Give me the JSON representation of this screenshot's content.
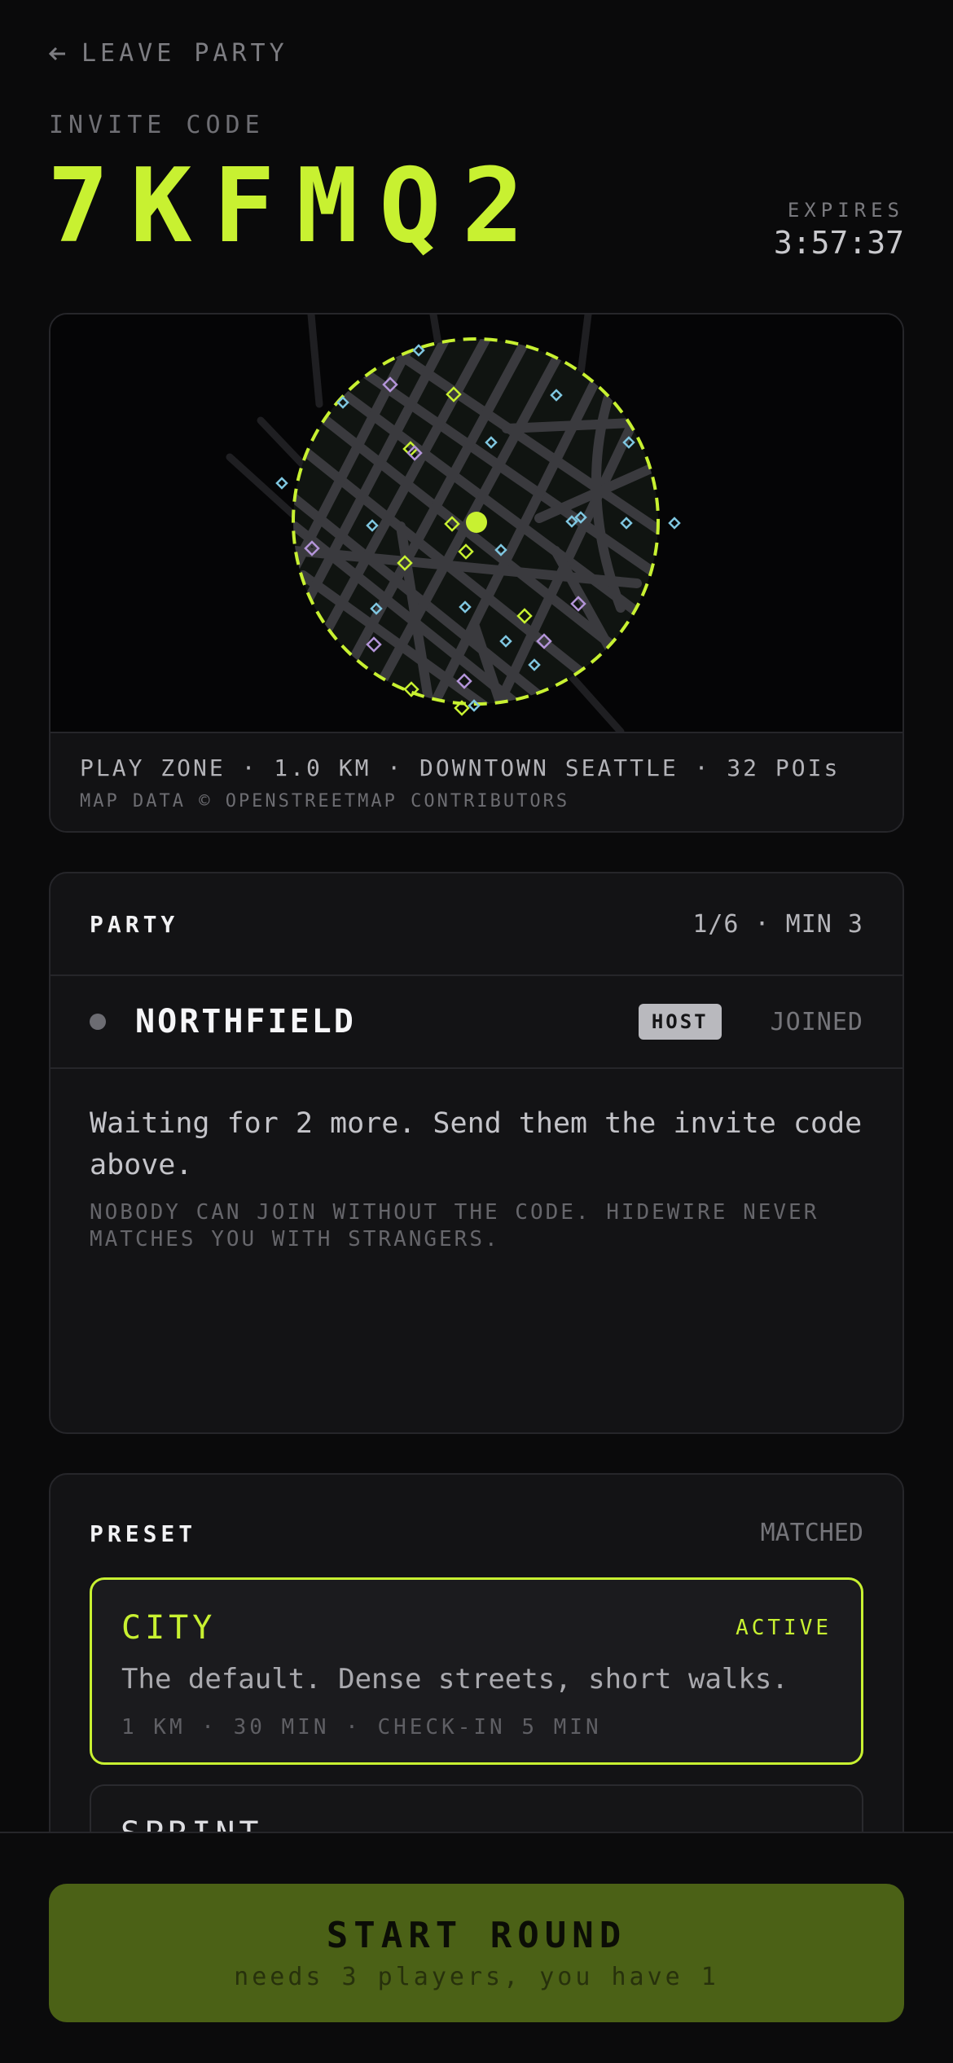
{
  "colors": {
    "accent": "#c8f131",
    "background": "#0a0a0b",
    "poi_blue": "#7fc6e0",
    "poi_purple": "#b394d8",
    "poi_green": "#c8f131"
  },
  "nav": {
    "leave_label": "LEAVE PARTY",
    "back_icon": "arrow-left-icon"
  },
  "invite": {
    "label": "INVITE CODE",
    "code": "7KFMQ2",
    "expires_label": "EXPIRES",
    "expires_value": "3:57:37"
  },
  "map": {
    "zone_line": "PLAY ZONE · 1.0 KM · DOWNTOWN SEATTLE · 32 POIs",
    "credit": "MAP DATA © OPENSTREETMAP CONTRIBUTORS",
    "pois": [
      {
        "c": "blue"
      },
      {
        "c": "blue"
      },
      {
        "c": "purple"
      },
      {
        "c": "green"
      },
      {
        "c": "blue"
      },
      {
        "c": "blue"
      },
      {
        "c": "blue"
      },
      {
        "c": "green"
      },
      {
        "c": "blue"
      },
      {
        "c": "purple"
      },
      {
        "c": "blue"
      },
      {
        "c": "blue"
      },
      {
        "c": "green"
      },
      {
        "c": "blue"
      },
      {
        "c": "purple"
      },
      {
        "c": "green"
      },
      {
        "c": "green"
      },
      {
        "c": "blue"
      },
      {
        "c": "blue"
      },
      {
        "c": "purple"
      },
      {
        "c": "blue"
      },
      {
        "c": "green"
      },
      {
        "c": "blue"
      },
      {
        "c": "purple"
      },
      {
        "c": "purple"
      },
      {
        "c": "blue"
      },
      {
        "c": "green"
      },
      {
        "c": "purple"
      },
      {
        "c": "blue"
      },
      {
        "c": "blue"
      },
      {
        "c": "green"
      },
      {
        "c": "blue"
      }
    ]
  },
  "party": {
    "title": "PARTY",
    "count": "1/6 · MIN 3",
    "members": [
      {
        "name": "NORTHFIELD",
        "badge": "HOST",
        "status": "JOINED"
      }
    ],
    "waiting_text": "Waiting for 2 more. Send them the invite code above.",
    "privacy_note": "NOBODY CAN JOIN WITHOUT THE CODE. HIDEWIRE NEVER MATCHES YOU WITH STRANGERS."
  },
  "preset": {
    "title": "PRESET",
    "status": "MATCHED",
    "options": [
      {
        "name": "CITY",
        "state": "ACTIVE",
        "description": "The default. Dense streets, short walks.",
        "meta": "1 KM · 30 MIN · CHECK-IN 5 MIN"
      },
      {
        "name": "SPRINT"
      }
    ]
  },
  "start": {
    "label": "START ROUND",
    "sub": "needs 3 players, you have 1"
  }
}
